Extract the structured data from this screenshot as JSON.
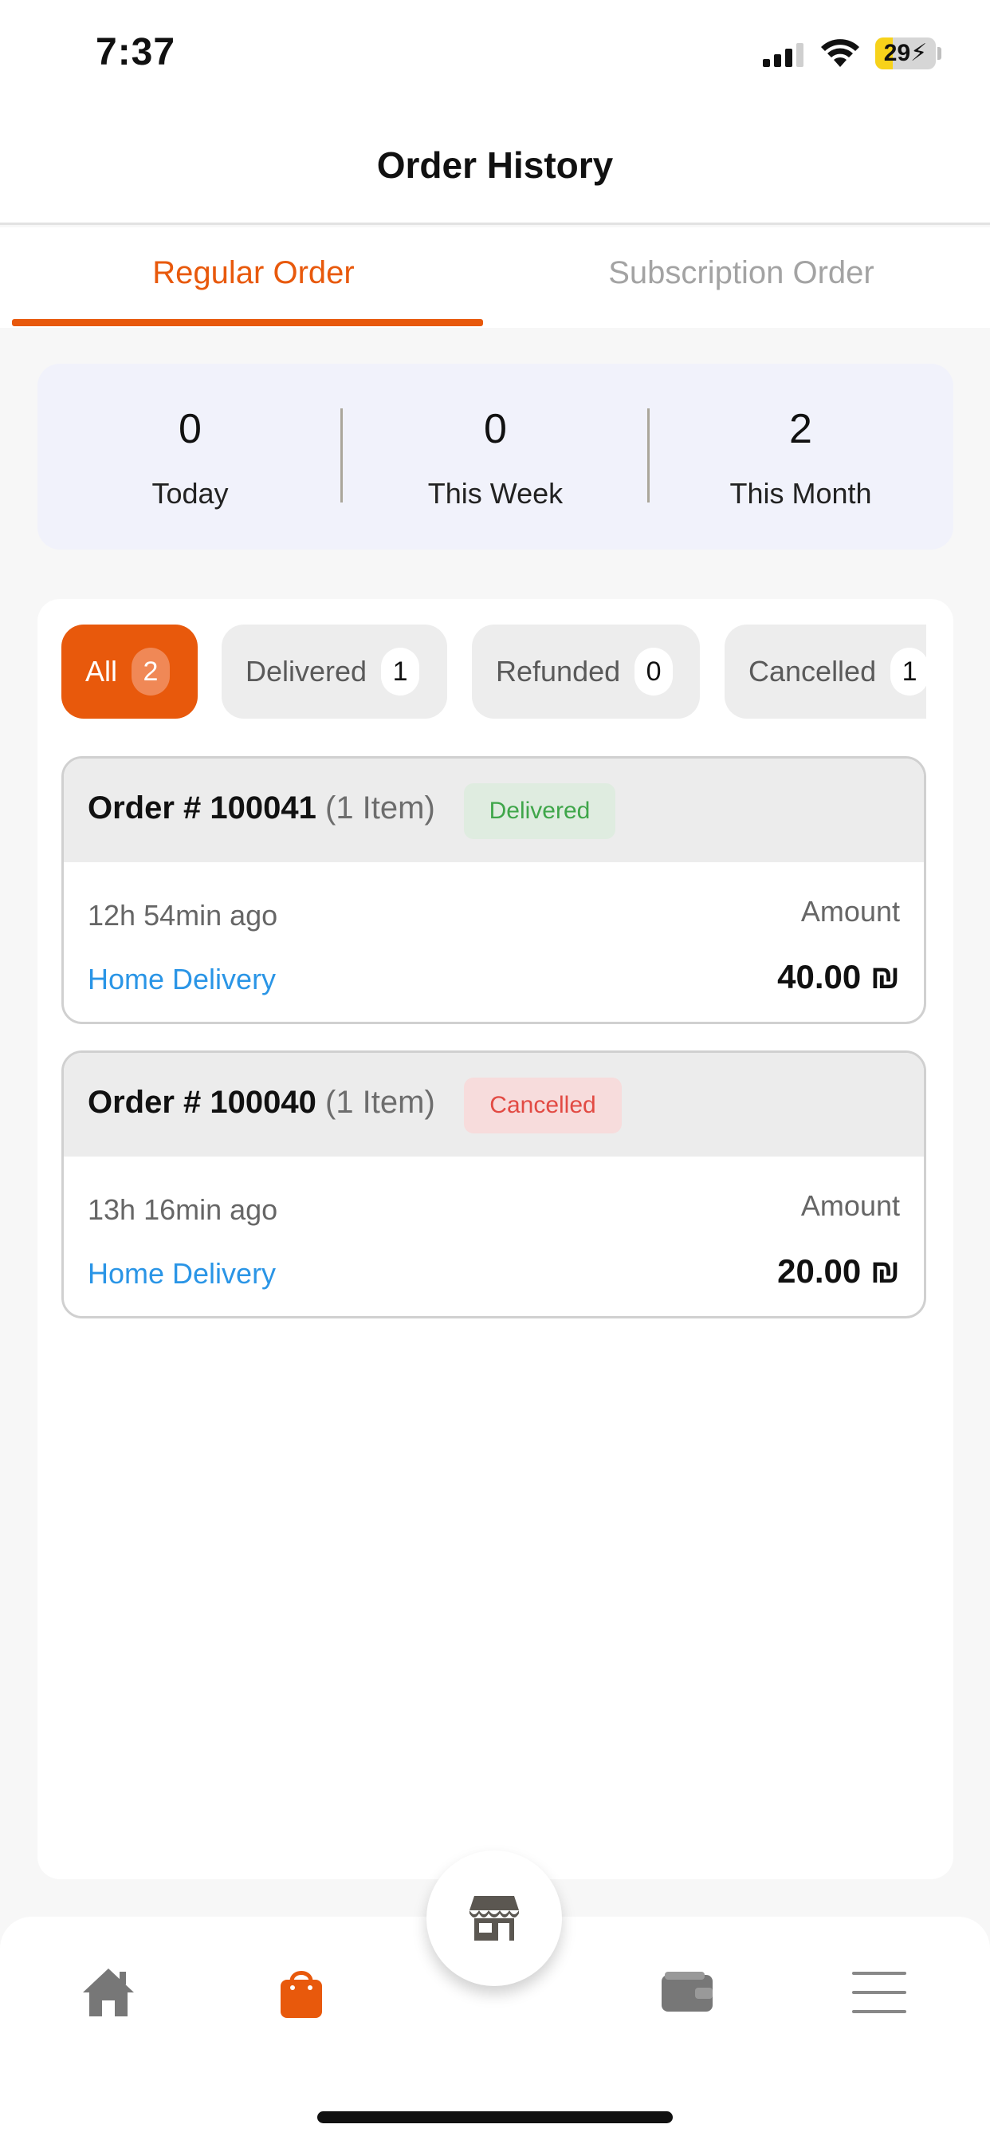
{
  "status_bar": {
    "time": "7:37",
    "battery": "29",
    "battery_level": 0.29
  },
  "header": {
    "title": "Order History"
  },
  "tabs": [
    {
      "label": "Regular Order",
      "active": true
    },
    {
      "label": "Subscription Order",
      "active": false
    }
  ],
  "summary": [
    {
      "value": "0",
      "label": "Today"
    },
    {
      "value": "0",
      "label": "This Week"
    },
    {
      "value": "2",
      "label": "This Month"
    }
  ],
  "filters": [
    {
      "label": "All",
      "count": "2",
      "active": true
    },
    {
      "label": "Delivered",
      "count": "1",
      "active": false
    },
    {
      "label": "Refunded",
      "count": "0",
      "active": false
    },
    {
      "label": "Cancelled",
      "count": "1",
      "active": false
    }
  ],
  "orders": [
    {
      "number": "Order # 100041",
      "items": "(1 Item)",
      "status": "Delivered",
      "time_ago": "12h 54min ago",
      "method": "Home Delivery",
      "amount_label": "Amount",
      "amount": "40.00 ₪"
    },
    {
      "number": "Order # 100040",
      "items": "(1 Item)",
      "status": "Cancelled",
      "time_ago": "13h 16min ago",
      "method": "Home Delivery",
      "amount_label": "Amount",
      "amount": "20.00 ₪"
    }
  ],
  "nav": {
    "items": [
      "home-icon",
      "shopping-bag-icon",
      "store-icon",
      "wallet-icon",
      "menu-icon"
    ],
    "active": "shopping-bag-icon"
  },
  "colors": {
    "accent": "#e8590c",
    "link": "#2a95e6",
    "delivered": "#3fa64a",
    "cancelled": "#e24a43",
    "summary_bg": "#f1f2fb"
  }
}
